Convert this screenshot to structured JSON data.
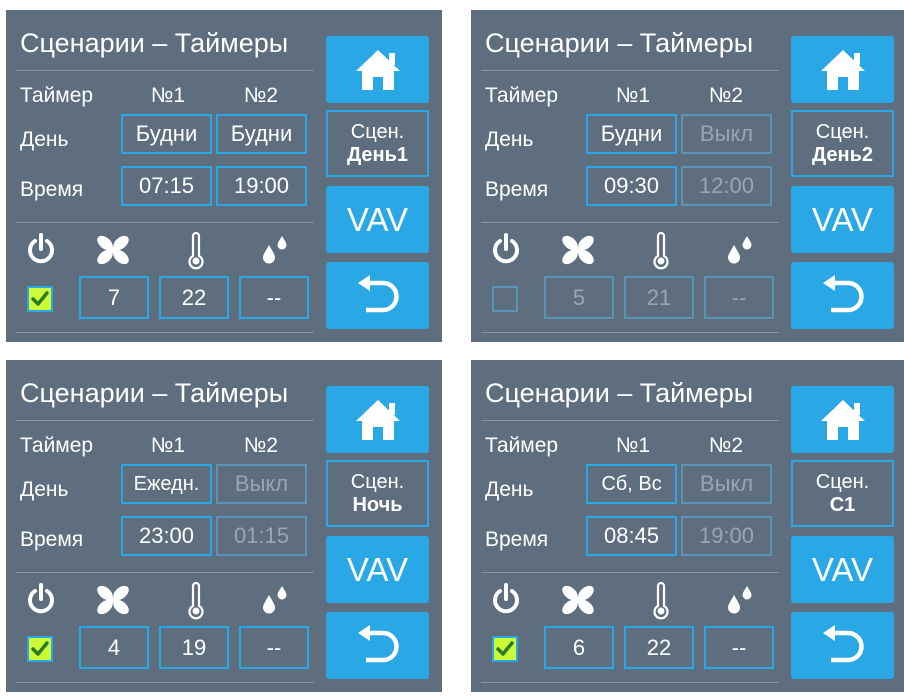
{
  "colors": {
    "panel_bg": "#5e6e7e",
    "accent": "#2aa8e6",
    "checked": "#ccfc38",
    "disabled_text": "#99a6b2"
  },
  "icons": [
    "home-icon",
    "back-arrow-icon",
    "power-icon",
    "fan-icon",
    "thermometer-icon",
    "humidity-icon"
  ],
  "panels": [
    {
      "title": "Сценарии – Таймеры",
      "timer_label": "Таймер",
      "day_label": "День",
      "time_label": "Время",
      "col1": "№1",
      "col2": "№2",
      "day1": "Будни",
      "day2": "Будни",
      "day2_enabled": true,
      "time1": "07:15",
      "time2": "19:00",
      "time2_enabled": true,
      "enabled": true,
      "fan": "7",
      "temp": "22",
      "humidity": "--",
      "scene_label": "Сцен.",
      "scene_name": "День1",
      "vav_label": "VAV"
    },
    {
      "title": "Сценарии – Таймеры",
      "timer_label": "Таймер",
      "day_label": "День",
      "time_label": "Время",
      "col1": "№1",
      "col2": "№2",
      "day1": "Будни",
      "day2": "Выкл",
      "day2_enabled": false,
      "time1": "09:30",
      "time2": "12:00",
      "time2_enabled": false,
      "enabled": false,
      "fan": "5",
      "temp": "21",
      "humidity": "--",
      "scene_label": "Сцен.",
      "scene_name": "День2",
      "vav_label": "VAV"
    },
    {
      "title": "Сценарии – Таймеры",
      "timer_label": "Таймер",
      "day_label": "День",
      "time_label": "Время",
      "col1": "№1",
      "col2": "№2",
      "day1": "Ежедн.",
      "day2": "Выкл",
      "day2_enabled": false,
      "time1": "23:00",
      "time2": "01:15",
      "time2_enabled": false,
      "enabled": true,
      "fan": "4",
      "temp": "19",
      "humidity": "--",
      "scene_label": "Сцен.",
      "scene_name": "Ночь",
      "vav_label": "VAV"
    },
    {
      "title": "Сценарии – Таймеры",
      "timer_label": "Таймер",
      "day_label": "День",
      "time_label": "Время",
      "col1": "№1",
      "col2": "№2",
      "day1": "Сб, Вс",
      "day2": "Выкл",
      "day2_enabled": false,
      "time1": "08:45",
      "time2": "19:00",
      "time2_enabled": false,
      "enabled": true,
      "fan": "6",
      "temp": "22",
      "humidity": "--",
      "scene_label": "Сцен.",
      "scene_name": "С1",
      "vav_label": "VAV"
    }
  ]
}
